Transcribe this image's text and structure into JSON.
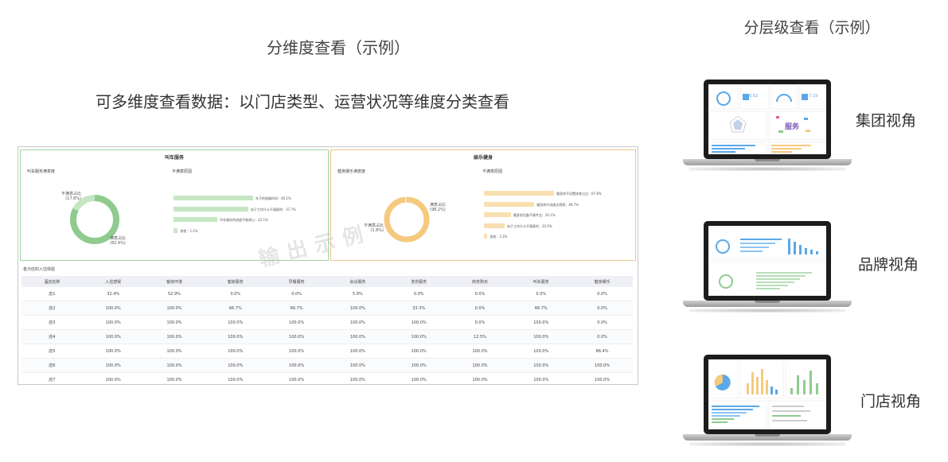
{
  "titles": {
    "main": "分维度查看（示例）",
    "subtitle": "可多维度查看数据：以门店类型、运营状况等维度分类查看",
    "right": "分层级查看（示例）"
  },
  "dashboard": {
    "left_panel": {
      "title": "叫车服务",
      "sat_label": "叫车服务满意度",
      "dissat_label": "不满意原因",
      "donut_top_label": "不满意占比",
      "donut_top_value": "(17.6%)",
      "donut_bottom_label": "满意占比",
      "donut_bottom_value": "(82.4%)",
      "satisfied_fraction": 0.824,
      "reasons": [
        {
          "label": "车子的准确时间：40.1%",
          "value": 40.1
        },
        {
          "label": "由于工作什么不满意的：37.7%",
          "value": 37.7
        },
        {
          "label": "叫车服务的态度不够热心：22.1%",
          "value": 22.1
        },
        {
          "label": "其他：2.1%",
          "value": 2.1
        }
      ]
    },
    "right_panel": {
      "title": "娱乐健身",
      "sat_label": "健身娱乐满意度",
      "dissat_label": "不满意原因",
      "donut_left_label": "不满意占比",
      "donut_left_value": "(1.8%)",
      "donut_right_label": "满意占比",
      "donut_right_value": "(98.2%)",
      "satisfied_fraction": 0.982,
      "reasons": [
        {
          "label": "健身房不设置体育占比：67.8%",
          "value": 67.8
        },
        {
          "label": "健身房内设施太简陋：48.7%",
          "value": 48.7
        },
        {
          "label": "健身房设备不够齐全：26.1%",
          "value": 26.1
        },
        {
          "label": "由于工作什么不满意的：20.0%",
          "value": 20.0
        },
        {
          "label": "其他：3.3%",
          "value": 3.3
        }
      ]
    },
    "watermark": "输出示例",
    "table": {
      "title": "各分店的入住体验",
      "headers": [
        "酒店名称",
        "入住感受",
        "客房环境",
        "客房服务",
        "早餐服务",
        "会议服务",
        "洗衣服务",
        "商务购买",
        "叫车服务",
        "健身娱乐"
      ],
      "rows": [
        [
          "店1",
          "32.4%",
          "52.9%",
          "0.0%",
          "0.0%",
          "5.9%",
          "0.0%",
          "0.0%",
          "0.0%",
          "0.0%"
        ],
        [
          "店2",
          "100.0%",
          "100.0%",
          "66.7%",
          "66.7%",
          "100.0%",
          "33.3%",
          "0.0%",
          "66.7%",
          "0.0%"
        ],
        [
          "店3",
          "100.0%",
          "100.0%",
          "100.0%",
          "100.0%",
          "100.0%",
          "100.0%",
          "0.0%",
          "100.0%",
          "0.0%"
        ],
        [
          "店4",
          "100.0%",
          "100.0%",
          "100.0%",
          "100.0%",
          "100.0%",
          "100.0%",
          "12.5%",
          "100.0%",
          "0.0%"
        ],
        [
          "店5",
          "100.0%",
          "100.0%",
          "100.0%",
          "100.0%",
          "100.0%",
          "100.0%",
          "100.0%",
          "100.0%",
          "86.4%"
        ],
        [
          "店6",
          "100.0%",
          "100.0%",
          "100.0%",
          "100.0%",
          "100.0%",
          "100.0%",
          "100.0%",
          "100.0%",
          "100.0%"
        ],
        [
          "店7",
          "100.0%",
          "100.0%",
          "100.0%",
          "100.0%",
          "100.0%",
          "100.0%",
          "100.0%",
          "100.0%",
          "100.0%"
        ]
      ]
    }
  },
  "views": [
    {
      "label": "集团视角",
      "kpi1": "8.62",
      "kpi2": "7.19",
      "word": "服务"
    },
    {
      "label": "品牌视角"
    },
    {
      "label": "门店视角"
    }
  ],
  "colors": {
    "green": "#8fcb8f",
    "green_light": "#c5e6c3",
    "orange": "#f5c97e",
    "orange_light": "#f9dfb0",
    "blue": "#5aa8e8",
    "border_green": "#9fd5a8",
    "border_orange": "#f0c48d"
  }
}
